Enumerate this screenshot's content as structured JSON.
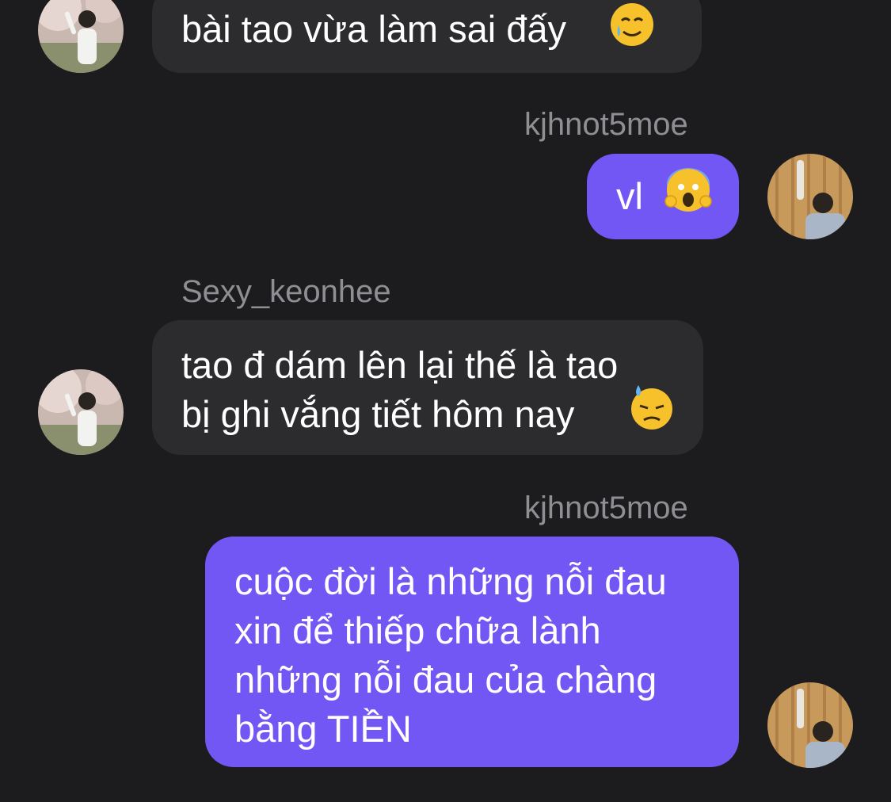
{
  "messages": [
    {
      "direction": "incoming",
      "lines": [
        "bài tao vừa làm sai đấy"
      ],
      "emoji": "smiling-face-with-tear-emoji"
    },
    {
      "direction": "outgoing",
      "sender": "kjhnot5moe",
      "lines": [
        "vl"
      ],
      "emoji": "face-screaming-in-fear-emoji"
    },
    {
      "direction": "incoming",
      "sender": "Sexy_keonhee",
      "lines": [
        "tao đ dám lên lại thế là tao",
        "bị ghi vắng tiết hôm nay"
      ],
      "emoji": "downcast-face-with-sweat-emoji"
    },
    {
      "direction": "outgoing",
      "sender": "kjhnot5moe",
      "lines": [
        "cuộc đời là những nỗi đau",
        "xin để thiếp chữa lành",
        "những nỗi đau của chàng",
        "bằng TIỀN"
      ]
    }
  ],
  "colors": {
    "background": "#1c1c1e",
    "incoming_bubble": "#2c2c2e",
    "outgoing_bubble": "#7357f5",
    "sender_name": "#8e8e93",
    "text": "#ffffff"
  }
}
